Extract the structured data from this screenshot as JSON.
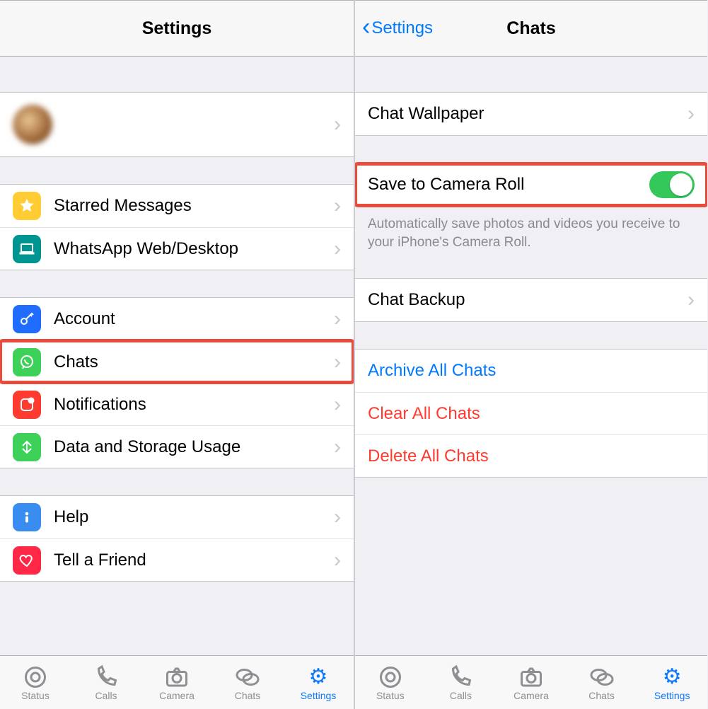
{
  "left": {
    "title": "Settings",
    "profile": {
      "name": "",
      "status": ""
    },
    "g1": {
      "starred": "Starred Messages",
      "web": "WhatsApp Web/Desktop"
    },
    "g2": {
      "account": "Account",
      "chats": "Chats",
      "notif": "Notifications",
      "data": "Data and Storage Usage"
    },
    "g3": {
      "help": "Help",
      "tell": "Tell a Friend"
    }
  },
  "right": {
    "back": "Settings",
    "title": "Chats",
    "wallpaper": "Chat Wallpaper",
    "save": "Save to Camera Roll",
    "save_note": "Automatically save photos and videos you receive to your iPhone's Camera Roll.",
    "backup": "Chat Backup",
    "archive": "Archive All Chats",
    "clear": "Clear All Chats",
    "delete": "Delete All Chats"
  },
  "tabs": {
    "status": "Status",
    "calls": "Calls",
    "camera": "Camera",
    "chats": "Chats",
    "settings": "Settings"
  }
}
